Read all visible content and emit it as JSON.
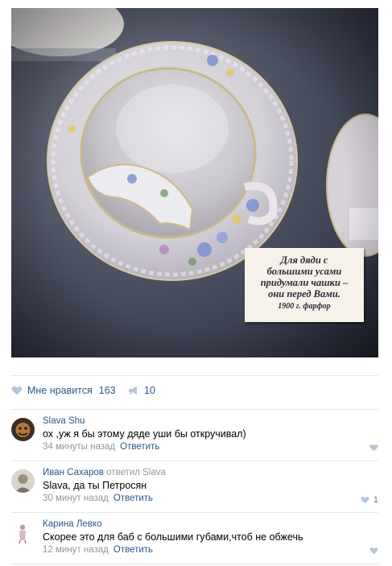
{
  "post": {
    "museum_card": {
      "lines": [
        "Для дяди с",
        "большими усами",
        "придумали чашки –",
        "они перед Вами.",
        "1900 г. фарфор"
      ]
    },
    "likes": {
      "label": "Мне нравится",
      "count": "163",
      "icon": "heart-icon"
    },
    "shares": {
      "count": "10",
      "icon": "megaphone-icon"
    }
  },
  "comments": [
    {
      "author": "Slava Shu",
      "replied_to": "",
      "text": "ох ,уж я бы этому дяде уши бы откручивал)",
      "time": "34 минуты назад",
      "reply_label": "Ответить",
      "likes": ""
    },
    {
      "author": "Иван Сахаров",
      "replied_to": "ответил Slava",
      "text": "Slava, да ты Петросян",
      "time": "30 минут назад",
      "reply_label": "Ответить",
      "likes": "1"
    },
    {
      "author": "Карина Левко",
      "replied_to": "",
      "text": "Скорее это для баб с большими губами,чтоб не обжечь",
      "time": "12 минут назад",
      "reply_label": "Ответить",
      "likes": ""
    }
  ],
  "colors": {
    "link": "#2a5885",
    "muted": "#939699",
    "divider": "#e7e8ec",
    "icon": "#b6c6d8"
  }
}
